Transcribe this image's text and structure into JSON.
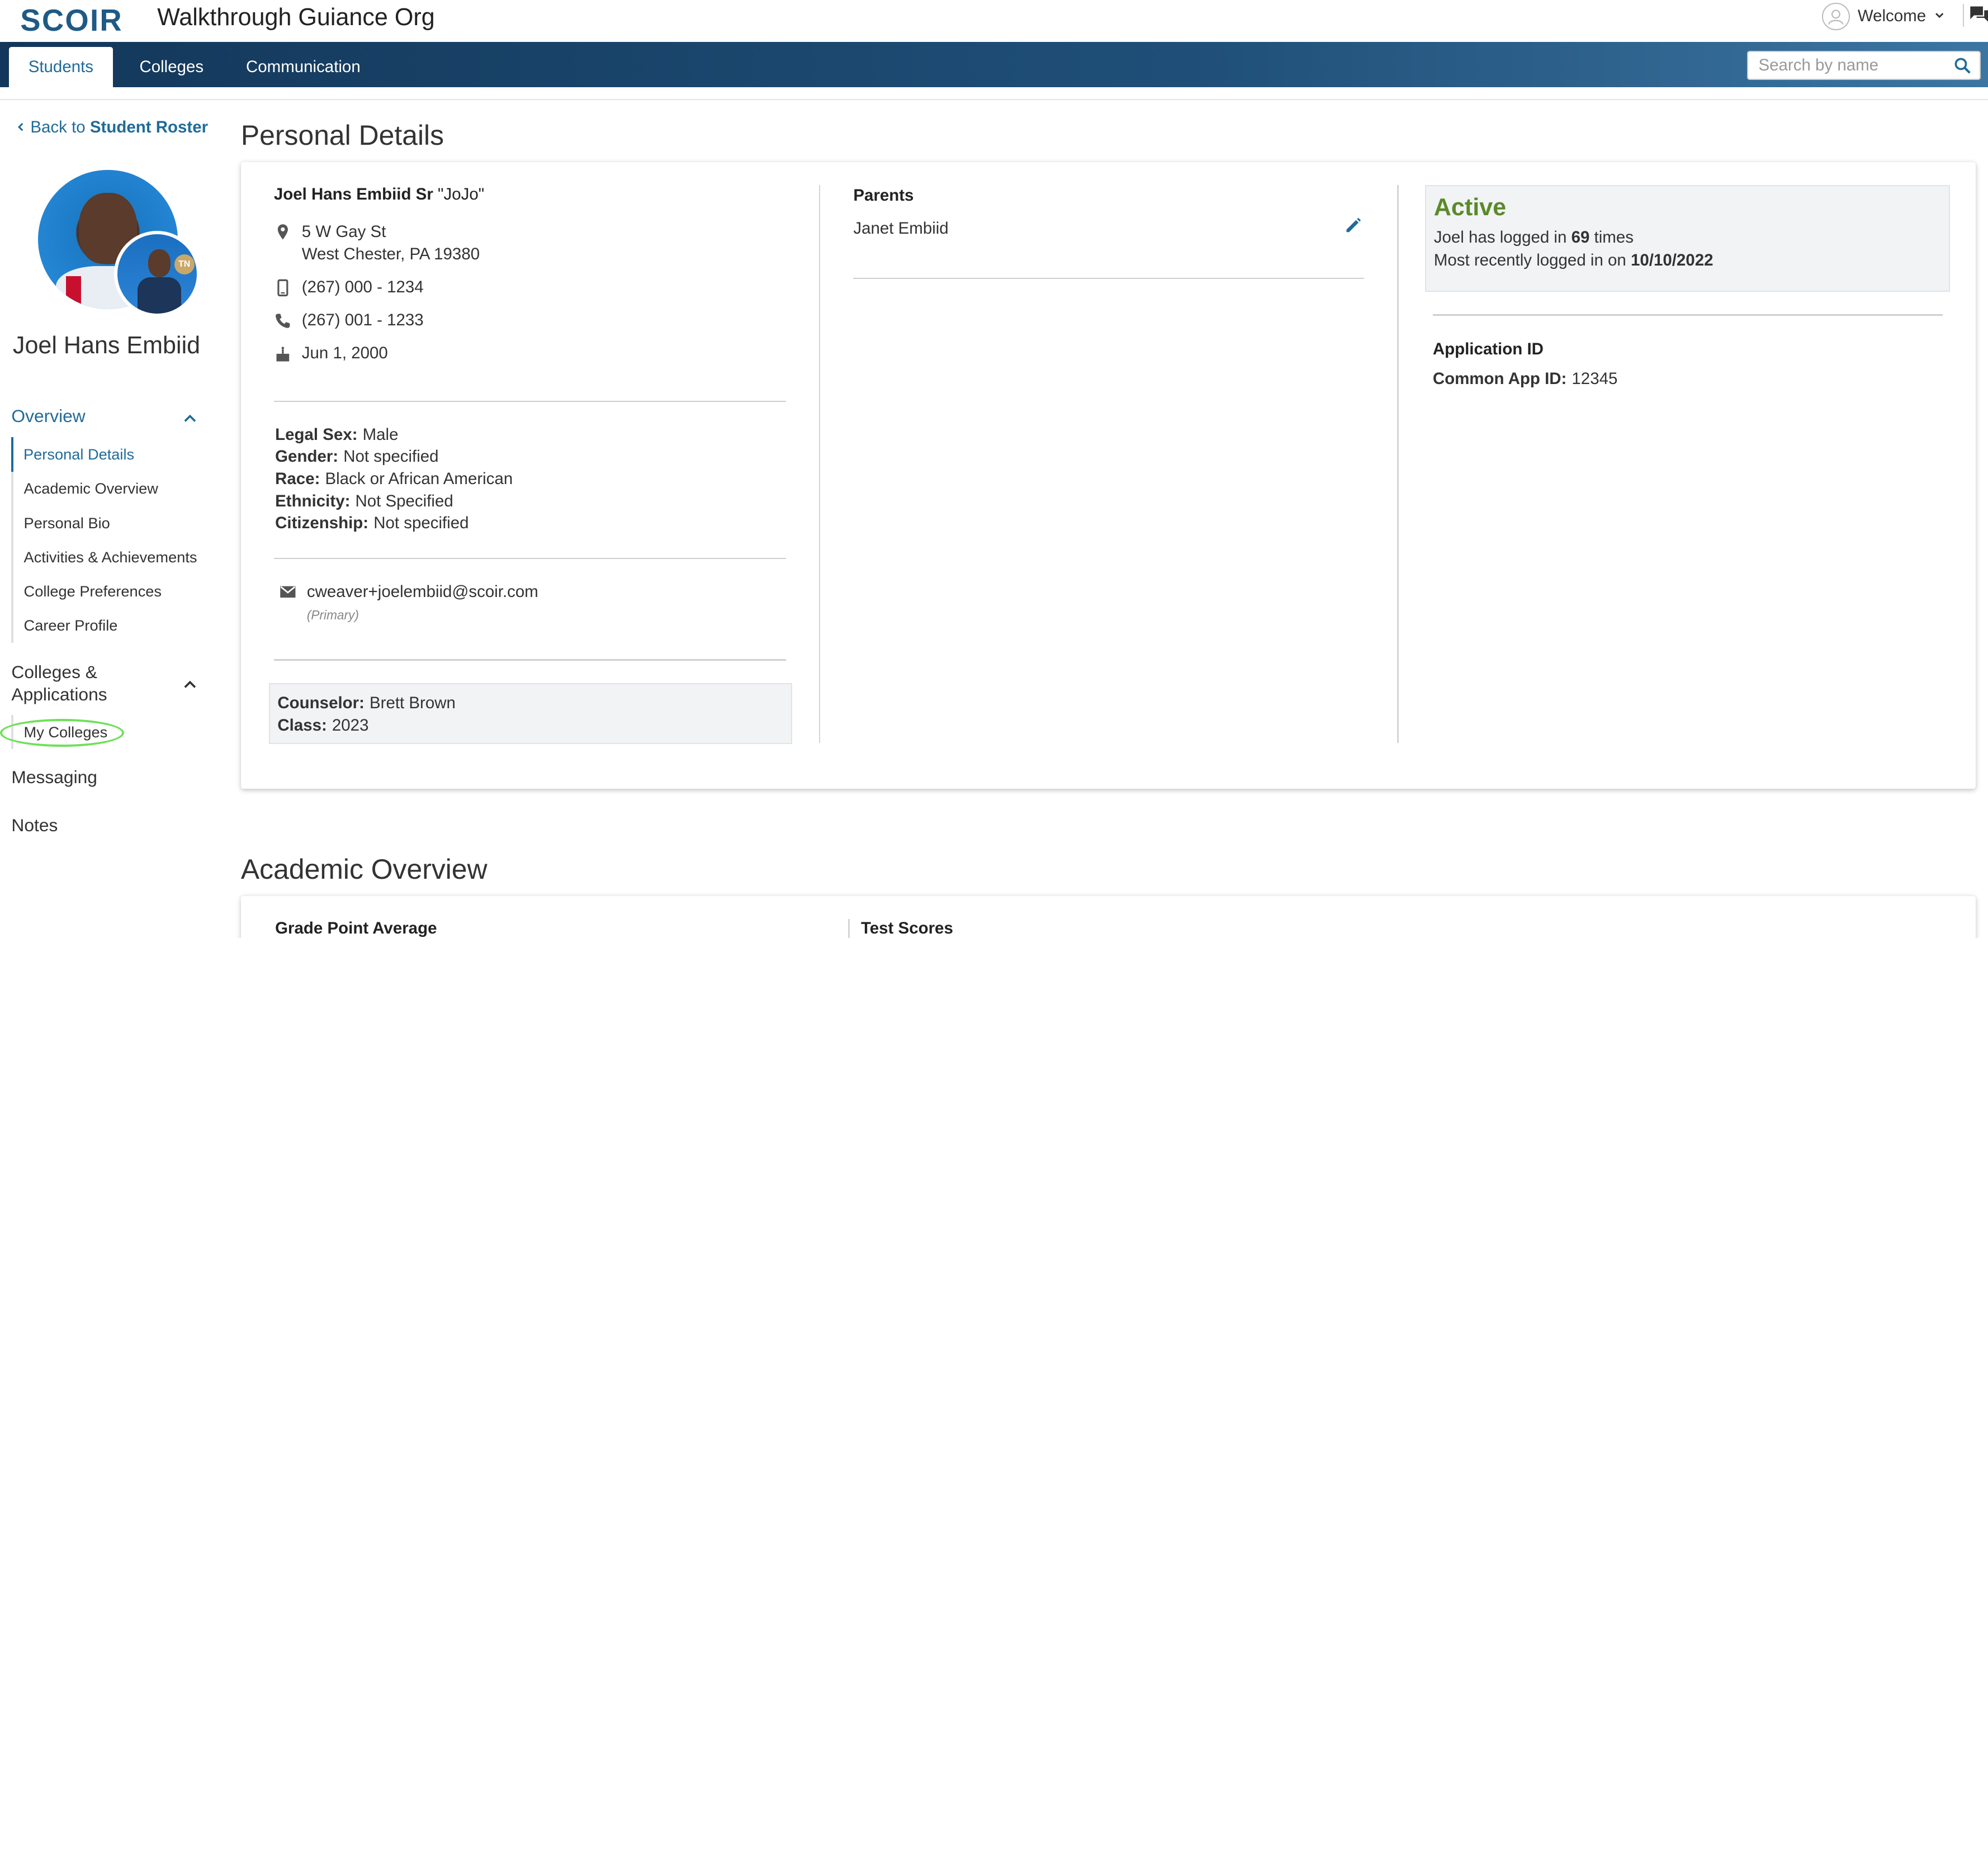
{
  "header": {
    "logo": "SCOIR",
    "org_name": "Walkthrough Guiance Org",
    "user_menu_label": "Welcome"
  },
  "nav": {
    "tabs": [
      {
        "label": "Students",
        "active": true
      },
      {
        "label": "Colleges",
        "active": false
      },
      {
        "label": "Communication",
        "active": false
      }
    ],
    "search_placeholder": "Search by name"
  },
  "sidebar": {
    "back_prefix": "Back to",
    "back_target": "Student Roster",
    "student_name": "Joel Hans Embiid",
    "photo_badge": "TN",
    "overview_label": "Overview",
    "overview_items": [
      {
        "label": "Personal Details",
        "current": true
      },
      {
        "label": "Academic Overview"
      },
      {
        "label": "Personal Bio"
      },
      {
        "label": "Activities & Achievements"
      },
      {
        "label": "College Preferences"
      },
      {
        "label": "Career Profile"
      }
    ],
    "colleges_label_line1": "Colleges &",
    "colleges_label_line2": "Applications",
    "colleges_items": [
      {
        "label": "My Colleges"
      }
    ],
    "messaging_label": "Messaging",
    "notes_label": "Notes"
  },
  "personal_details": {
    "title": "Personal Details",
    "full_name": "Joel Hans Embiid Sr",
    "nickname": "\"JoJo\"",
    "address_line1": "5 W Gay St",
    "address_line2": "West Chester, PA 19380",
    "mobile": "(267) 000 - 1234",
    "phone": "(267) 001 - 1233",
    "birthday": "Jun 1, 2000",
    "legal_sex_label": "Legal Sex:",
    "legal_sex": "Male",
    "gender_label": "Gender:",
    "gender": "Not specified",
    "race_label": "Race:",
    "race": "Black or African American",
    "ethnicity_label": "Ethnicity:",
    "ethnicity": "Not Specified",
    "citizenship_label": "Citizenship:",
    "citizenship": "Not specified",
    "email": "cweaver+joelembiid@scoir.com",
    "email_note": "(Primary)",
    "counselor_label": "Counselor:",
    "counselor": "Brett Brown",
    "class_label": "Class:",
    "class_year": "2023",
    "parents_label": "Parents",
    "parent_name": "Janet Embiid",
    "status": "Active",
    "login_prefix": "Joel has logged in",
    "login_count": "69",
    "login_suffix": "times",
    "recent_prefix": "Most recently logged in on",
    "recent_date": "10/10/2022",
    "app_id_label": "Application ID",
    "common_app_label": "Common App ID:",
    "common_app_id": "12345"
  },
  "academic_overview": {
    "title": "Academic Overview",
    "gpa_label": "Grade Point Average",
    "test_scores_label": "Test Scores"
  },
  "colors": {
    "brand": "#1f5a85",
    "link": "#1f6b99",
    "active_status": "#5b8a2a",
    "highlight": "#6fe05a"
  }
}
